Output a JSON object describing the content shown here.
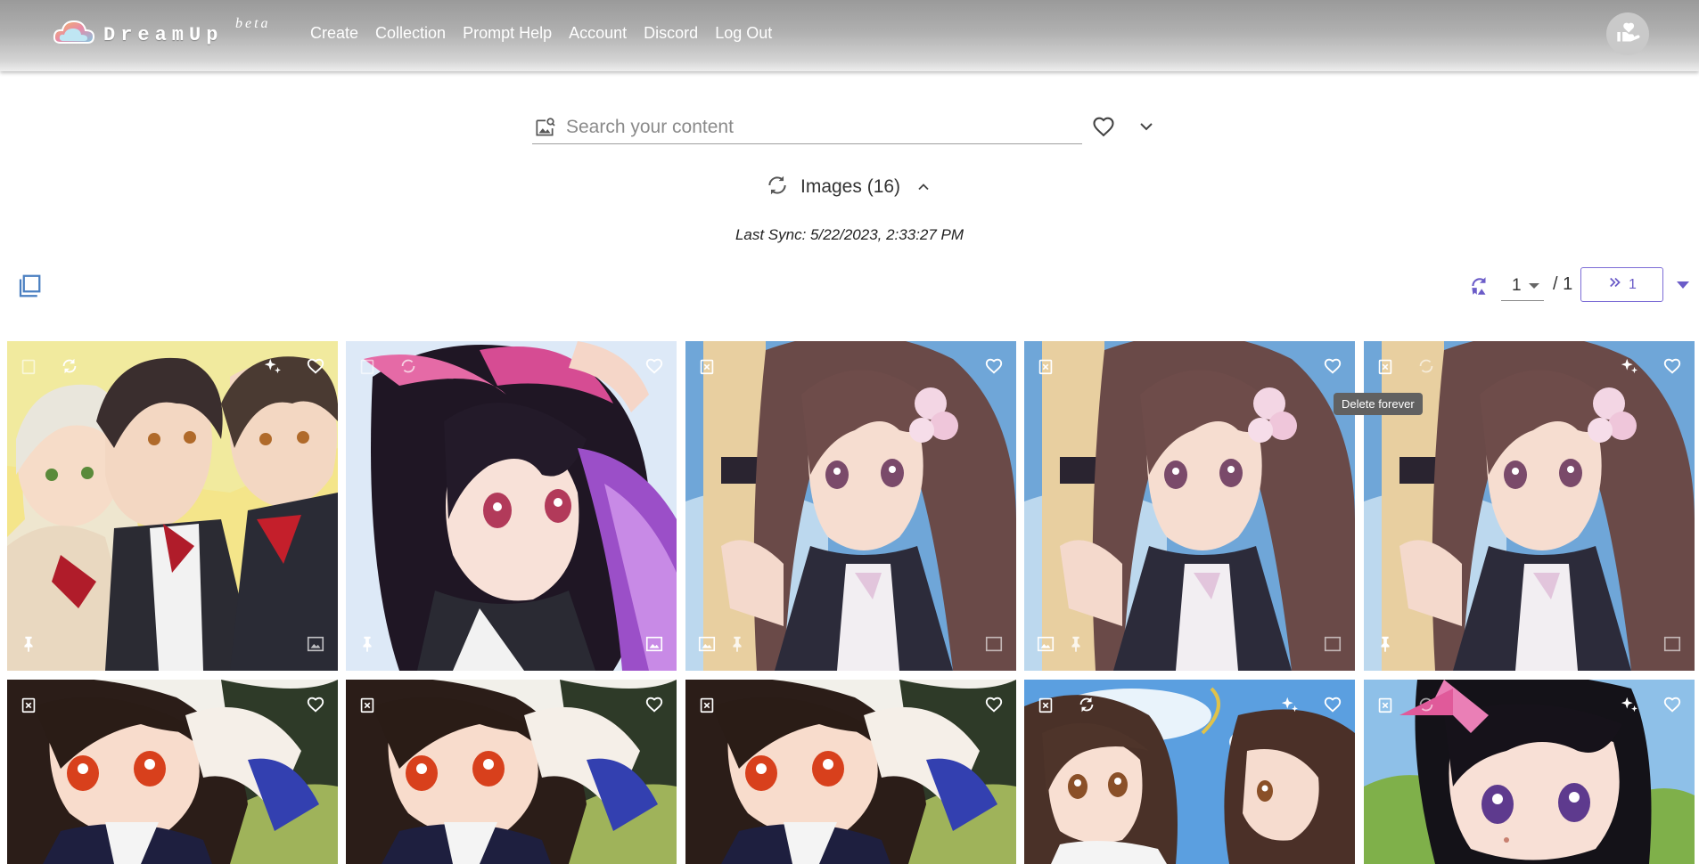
{
  "header": {
    "logo_text": "DreamUp",
    "logo_beta": "beta",
    "nav": [
      "Create",
      "Collection",
      "Prompt Help",
      "Account",
      "Discord",
      "Log Out"
    ]
  },
  "search": {
    "placeholder": "Search your content",
    "value": ""
  },
  "images": {
    "label": "Images (16)",
    "last_sync": "Last Sync: 5/22/2023, 2:33:27 PM"
  },
  "pagination": {
    "current_page": "1",
    "total": "/ 1",
    "jump_label": "1"
  },
  "tooltip": "Delete forever",
  "colors": {
    "accent": "#6b5cc8",
    "header_gradient_top": "#9a9a9a",
    "header_gradient_bottom": "#eeeeee"
  },
  "cards": [
    {
      "theme": "group-school",
      "icons": [
        "delete-icon",
        "regenerate-icon",
        "enhance-icon",
        "favorite-icon",
        "pin-icon",
        "image-icon"
      ]
    },
    {
      "theme": "purple-hair",
      "icons": [
        "delete-icon",
        "regenerate-icon",
        "favorite-icon",
        "pin-icon",
        "image-icon"
      ]
    },
    {
      "theme": "brown-hair-flower",
      "icons": [
        "delete-icon",
        "favorite-icon",
        "image-icon",
        "pin-icon",
        "image-icon"
      ]
    },
    {
      "theme": "brown-hair-flower",
      "icons": [
        "delete-icon",
        "favorite-icon",
        "image-icon",
        "pin-icon",
        "image-icon"
      ]
    },
    {
      "theme": "brown-hair-flower",
      "icons": [
        "delete-icon",
        "regenerate-icon",
        "enhance-icon",
        "favorite-icon",
        "pin-icon",
        "image-icon"
      ]
    },
    {
      "theme": "red-eyes-meadow",
      "icons": [
        "delete-icon",
        "favorite-icon"
      ]
    },
    {
      "theme": "red-eyes-meadow",
      "icons": [
        "delete-icon",
        "favorite-icon"
      ]
    },
    {
      "theme": "red-eyes-meadow",
      "icons": [
        "delete-icon",
        "favorite-icon"
      ]
    },
    {
      "theme": "two-girls-sky",
      "icons": [
        "delete-icon",
        "regenerate-icon",
        "enhance-icon",
        "favorite-icon"
      ]
    },
    {
      "theme": "black-hair-pink-bow",
      "icons": [
        "delete-icon",
        "regenerate-icon",
        "enhance-icon",
        "favorite-icon"
      ]
    }
  ]
}
